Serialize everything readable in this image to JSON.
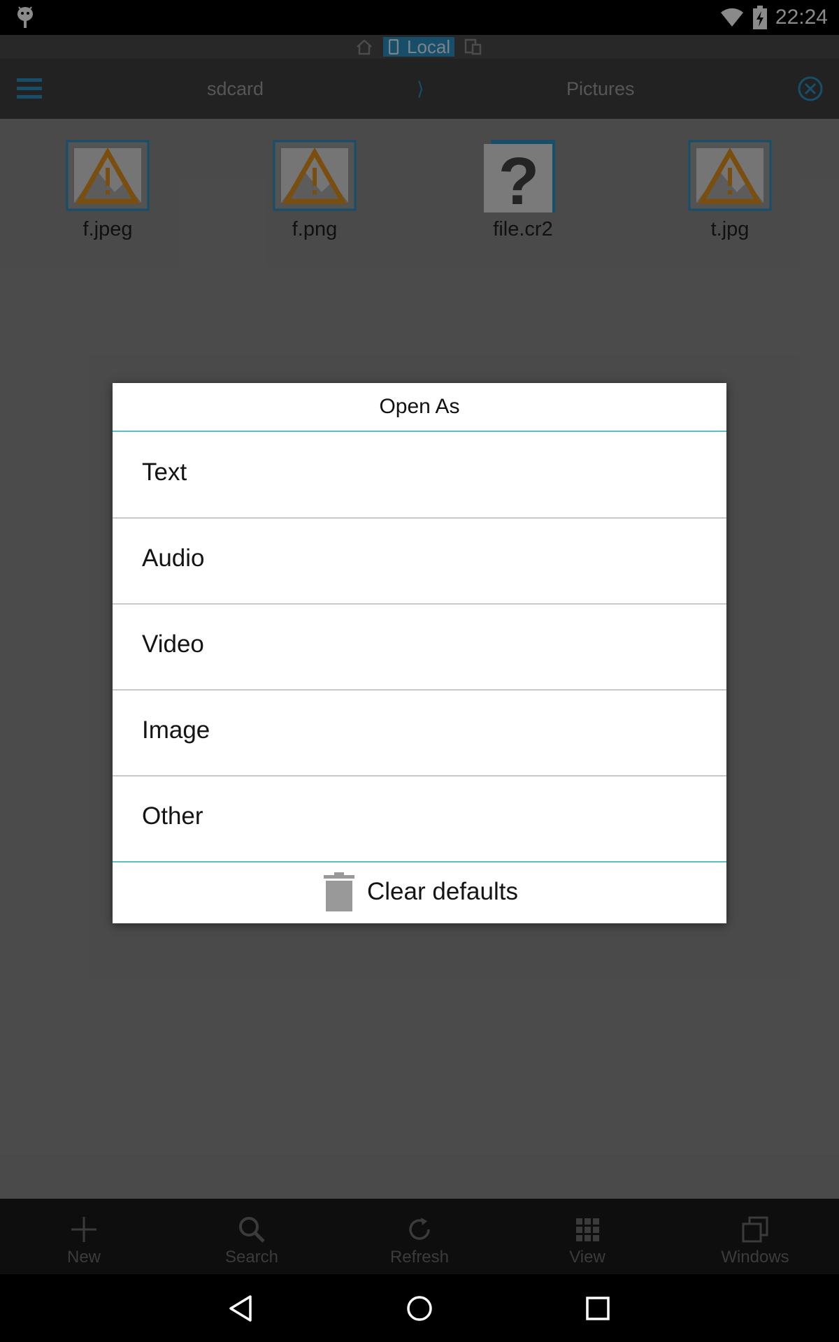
{
  "status_bar": {
    "time": "22:24"
  },
  "location_bar": {
    "active_tab": "Local"
  },
  "toolbar": {
    "breadcrumbs": [
      "sdcard",
      "Pictures"
    ],
    "separator": "⟩"
  },
  "files": [
    {
      "name": "f.jpeg",
      "icon": "broken-image-icon"
    },
    {
      "name": "f.png",
      "icon": "broken-image-icon"
    },
    {
      "name": "file.cr2",
      "icon": "unknown-file-icon"
    },
    {
      "name": "t.jpg",
      "icon": "broken-image-icon"
    }
  ],
  "dialog": {
    "title": "Open As",
    "options": [
      "Text",
      "Audio",
      "Video",
      "Image",
      "Other"
    ],
    "clear_label": "Clear defaults"
  },
  "bottom_bar": {
    "actions": [
      "New",
      "Search",
      "Refresh",
      "View",
      "Windows"
    ]
  },
  "colors": {
    "accent": "#2c93c4",
    "divider_accent": "#59bfc4",
    "warning": "#e0901c"
  }
}
